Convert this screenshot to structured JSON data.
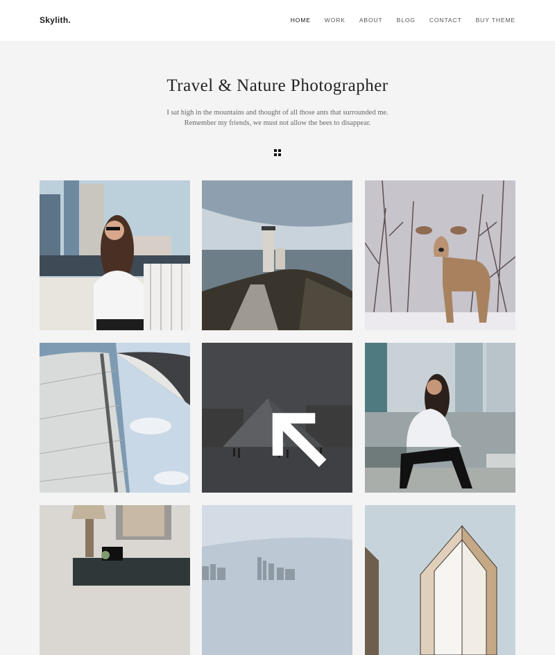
{
  "header": {
    "logo": "Skylith.",
    "nav": [
      {
        "label": "HOME",
        "active": true
      },
      {
        "label": "WORK",
        "active": false
      },
      {
        "label": "ABOUT",
        "active": false
      },
      {
        "label": "BLOG",
        "active": false
      },
      {
        "label": "CONTACT",
        "active": false
      },
      {
        "label": "BUY THEME",
        "active": false
      }
    ]
  },
  "hero": {
    "title": "Travel & Nature Photographer",
    "subtitle_line1": "I sat high in the mountains and thought of all those ants that surrounded me.",
    "subtitle_line2": "Remember my friends, we must not allow the bees to disappear."
  },
  "filter": {
    "icon": "grid-icon"
  },
  "gallery": {
    "items": [
      {
        "subject": "woman-city-photo"
      },
      {
        "subject": "lighthouse-photo"
      },
      {
        "subject": "deer-snow-photo"
      },
      {
        "subject": "sail-photo"
      },
      {
        "subject": "louvre-pyramid-photo",
        "hover_icon": "expand-icon"
      },
      {
        "subject": "woman-sitting-photo"
      },
      {
        "subject": "lamp-interior-photo"
      },
      {
        "subject": "coastal-city-photo"
      },
      {
        "subject": "building-angle-photo"
      }
    ]
  }
}
